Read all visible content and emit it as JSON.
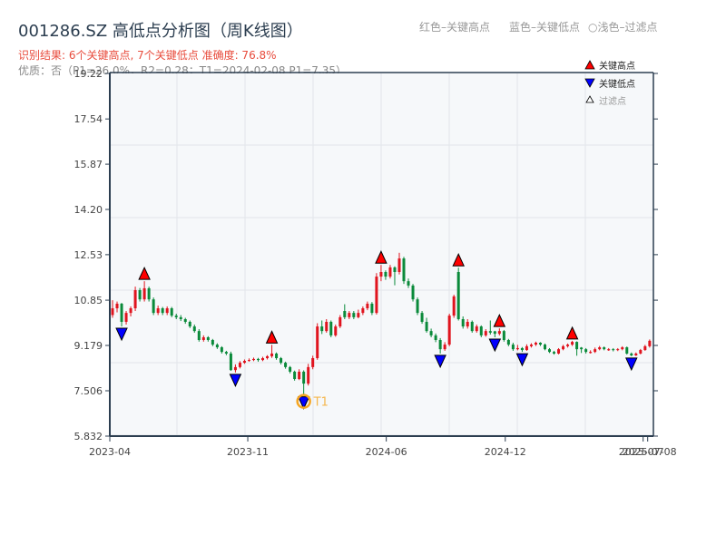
{
  "header": {
    "title": "001286.SZ 高低点分析图（周K线图）",
    "result": "识别结果: 6个关键高点, 7个关键低点  准确度: 76.8%",
    "quality": "优质：否（P1=26.0%，R2=0.28；T1=2024-02-08 P1=7.35）"
  },
  "top_legend": {
    "red": "红色–关键高点",
    "blue": "蓝色–关键低点",
    "light": "○浅色–过滤点"
  },
  "chart_data": {
    "type": "candlestick",
    "title": "001286.SZ 高低点分析图（周K线图）",
    "y_ticks": [
      "5.832",
      "7.506",
      "9.179",
      "10.85",
      "12.53",
      "14.20",
      "15.87",
      "17.54",
      "19.22"
    ],
    "ylim": [
      5.832,
      19.22
    ],
    "x_ticks": [
      {
        "label": "2023-04",
        "date": "2023-04-07"
      },
      {
        "label": "2023-11",
        "date": "2023-11-01"
      },
      {
        "label": "2024-06",
        "date": "2024-06-01"
      },
      {
        "label": "2024-12",
        "date": "2024-12-01"
      },
      {
        "label": "2025-07",
        "date": "2025-07-01"
      },
      {
        "label": "2025-07-08",
        "date": "2025-07-08"
      }
    ],
    "xlim": [
      "2023-04-07",
      "2025-07-14"
    ],
    "grid": true,
    "colors": {
      "up": "#e0141e",
      "down": "#0a8a3a",
      "high_marker": "#ff0000",
      "low_marker": "#0000ff",
      "t1": "#f5a623",
      "plot_bg": "#f6f8fa"
    },
    "dates": [
      "2023-04-07",
      "2023-04-14",
      "2023-04-21",
      "2023-04-28",
      "2023-05-05",
      "2023-05-12",
      "2023-05-19",
      "2023-05-26",
      "2023-06-02",
      "2023-06-09",
      "2023-06-16",
      "2023-06-23",
      "2023-06-30",
      "2023-07-07",
      "2023-07-14",
      "2023-07-21",
      "2023-07-28",
      "2023-08-04",
      "2023-08-11",
      "2023-08-18",
      "2023-08-25",
      "2023-09-01",
      "2023-09-08",
      "2023-09-15",
      "2023-09-22",
      "2023-09-29",
      "2023-10-06",
      "2023-10-13",
      "2023-10-20",
      "2023-10-27",
      "2023-11-03",
      "2023-11-10",
      "2023-11-17",
      "2023-11-24",
      "2023-12-01",
      "2023-12-08",
      "2023-12-15",
      "2023-12-22",
      "2023-12-29",
      "2024-01-05",
      "2024-01-12",
      "2024-01-19",
      "2024-01-26",
      "2024-02-02",
      "2024-02-09",
      "2024-02-16",
      "2024-02-23",
      "2024-03-01",
      "2024-03-08",
      "2024-03-15",
      "2024-03-22",
      "2024-03-29",
      "2024-04-05",
      "2024-04-12",
      "2024-04-19",
      "2024-04-26",
      "2024-05-03",
      "2024-05-10",
      "2024-05-17",
      "2024-05-24",
      "2024-05-31",
      "2024-06-07",
      "2024-06-14",
      "2024-06-21",
      "2024-06-28",
      "2024-07-05",
      "2024-07-12",
      "2024-07-19",
      "2024-07-26",
      "2024-08-02",
      "2024-08-09",
      "2024-08-16",
      "2024-08-23",
      "2024-08-30",
      "2024-09-06",
      "2024-09-13",
      "2024-09-20",
      "2024-09-27",
      "2024-10-04",
      "2024-10-11",
      "2024-10-18",
      "2024-10-25",
      "2024-11-01",
      "2024-11-08",
      "2024-11-15",
      "2024-11-22",
      "2024-11-29",
      "2024-12-06",
      "2024-12-13",
      "2024-12-20",
      "2024-12-27",
      "2025-01-03",
      "2025-01-10",
      "2025-01-17",
      "2025-01-24",
      "2025-01-31",
      "2025-02-07",
      "2025-02-14",
      "2025-02-21",
      "2025-02-28",
      "2025-03-07",
      "2025-03-14",
      "2025-03-21",
      "2025-03-28",
      "2025-04-04",
      "2025-04-11",
      "2025-04-18",
      "2025-04-25",
      "2025-05-02",
      "2025-05-09",
      "2025-05-16",
      "2025-05-23",
      "2025-05-30",
      "2025-06-06",
      "2025-06-13",
      "2025-06-20",
      "2025-06-27",
      "2025-07-04",
      "2025-07-11"
    ],
    "ohlc": [
      [
        10.3,
        10.85,
        10.2,
        10.55
      ],
      [
        10.55,
        10.8,
        10.4,
        10.72
      ],
      [
        10.72,
        10.75,
        9.88,
        10.05
      ],
      [
        10.05,
        10.45,
        9.95,
        10.38
      ],
      [
        10.38,
        10.62,
        10.25,
        10.55
      ],
      [
        10.55,
        11.35,
        10.45,
        11.22
      ],
      [
        11.22,
        11.3,
        10.8,
        10.88
      ],
      [
        10.88,
        11.55,
        10.8,
        11.29
      ],
      [
        11.29,
        11.35,
        10.8,
        10.88
      ],
      [
        10.88,
        10.95,
        10.3,
        10.38
      ],
      [
        10.38,
        10.65,
        10.3,
        10.55
      ],
      [
        10.55,
        10.6,
        10.3,
        10.38
      ],
      [
        10.38,
        10.62,
        10.3,
        10.55
      ],
      [
        10.55,
        10.6,
        10.22,
        10.28
      ],
      [
        10.28,
        10.35,
        10.15,
        10.22
      ],
      [
        10.22,
        10.3,
        10.08,
        10.15
      ],
      [
        10.15,
        10.2,
        9.98,
        10.05
      ],
      [
        10.05,
        10.1,
        9.82,
        9.88
      ],
      [
        9.88,
        9.95,
        9.65,
        9.71
      ],
      [
        9.71,
        9.78,
        9.32,
        9.38
      ],
      [
        9.38,
        9.55,
        9.32,
        9.48
      ],
      [
        9.48,
        9.52,
        9.32,
        9.38
      ],
      [
        9.38,
        9.42,
        9.15,
        9.21
      ],
      [
        9.21,
        9.26,
        9.05,
        9.11
      ],
      [
        9.11,
        9.15,
        8.88,
        8.94
      ],
      [
        8.94,
        8.98,
        8.82,
        8.88
      ],
      [
        8.88,
        8.95,
        8.24,
        8.27
      ],
      [
        8.27,
        8.48,
        8.18,
        8.38
      ],
      [
        8.38,
        8.6,
        8.33,
        8.54
      ],
      [
        8.54,
        8.66,
        8.5,
        8.61
      ],
      [
        8.61,
        8.7,
        8.58,
        8.64
      ],
      [
        8.64,
        8.73,
        8.6,
        8.68
      ],
      [
        8.68,
        8.72,
        8.58,
        8.64
      ],
      [
        8.64,
        8.76,
        8.6,
        8.71
      ],
      [
        8.71,
        8.82,
        8.66,
        8.78
      ],
      [
        8.78,
        9.2,
        8.72,
        8.88
      ],
      [
        8.88,
        8.92,
        8.65,
        8.71
      ],
      [
        8.71,
        8.75,
        8.48,
        8.54
      ],
      [
        8.54,
        8.58,
        8.32,
        8.38
      ],
      [
        8.38,
        8.42,
        8.15,
        8.21
      ],
      [
        8.21,
        8.25,
        7.88,
        7.94
      ],
      [
        7.94,
        8.3,
        7.9,
        8.21
      ],
      [
        8.21,
        8.26,
        7.35,
        7.77
      ],
      [
        7.77,
        8.5,
        7.7,
        8.38
      ],
      [
        8.38,
        8.8,
        8.3,
        8.71
      ],
      [
        8.71,
        10.0,
        8.65,
        9.88
      ],
      [
        9.88,
        10.1,
        9.6,
        9.71
      ],
      [
        9.71,
        10.15,
        9.65,
        10.05
      ],
      [
        10.05,
        10.1,
        9.48,
        9.55
      ],
      [
        9.55,
        9.95,
        9.5,
        9.88
      ],
      [
        9.88,
        10.3,
        9.82,
        10.22
      ],
      [
        10.45,
        10.7,
        10.15,
        10.22
      ],
      [
        10.22,
        10.45,
        10.15,
        10.38
      ],
      [
        10.38,
        10.45,
        10.15,
        10.22
      ],
      [
        10.22,
        10.5,
        10.18,
        10.38
      ],
      [
        10.38,
        10.62,
        10.3,
        10.55
      ],
      [
        10.55,
        10.8,
        10.48,
        10.72
      ],
      [
        10.72,
        10.78,
        10.3,
        10.38
      ],
      [
        10.38,
        11.85,
        10.32,
        11.72
      ],
      [
        11.72,
        12.15,
        11.55,
        11.89
      ],
      [
        11.89,
        11.95,
        11.6,
        11.72
      ],
      [
        11.72,
        12.15,
        11.65,
        12.06
      ],
      [
        12.06,
        12.1,
        11.4,
        11.89
      ],
      [
        11.89,
        12.6,
        11.8,
        12.39
      ],
      [
        12.39,
        12.45,
        11.45,
        11.55
      ],
      [
        11.55,
        11.65,
        11.3,
        11.39
      ],
      [
        11.39,
        11.45,
        10.8,
        10.88
      ],
      [
        10.88,
        10.95,
        10.3,
        10.38
      ],
      [
        10.38,
        10.45,
        9.98,
        10.05
      ],
      [
        10.05,
        10.2,
        9.65,
        9.71
      ],
      [
        9.71,
        9.8,
        9.48,
        9.55
      ],
      [
        9.55,
        9.62,
        9.3,
        9.38
      ],
      [
        9.38,
        9.45,
        8.88,
        9.04
      ],
      [
        9.04,
        9.3,
        8.98,
        9.21
      ],
      [
        9.21,
        10.35,
        9.15,
        10.28
      ],
      [
        10.28,
        11.05,
        10.2,
        10.99
      ],
      [
        11.89,
        12.05,
        10.1,
        10.15
      ],
      [
        10.15,
        10.25,
        9.8,
        9.88
      ],
      [
        9.88,
        10.15,
        9.8,
        10.05
      ],
      [
        10.05,
        10.1,
        9.65,
        9.71
      ],
      [
        9.71,
        9.95,
        9.65,
        9.88
      ],
      [
        9.88,
        9.92,
        9.48,
        9.55
      ],
      [
        9.55,
        9.78,
        9.5,
        9.71
      ],
      [
        9.71,
        10.1,
        9.58,
        9.65
      ],
      [
        9.7,
        9.72,
        9.48,
        9.61
      ],
      [
        9.61,
        9.81,
        9.55,
        9.71
      ],
      [
        9.71,
        9.75,
        9.32,
        9.38
      ],
      [
        9.38,
        9.42,
        9.15,
        9.21
      ],
      [
        9.21,
        9.28,
        8.98,
        9.04
      ],
      [
        9.04,
        9.2,
        9.0,
        9.08
      ],
      [
        9.08,
        9.12,
        8.94,
        9.01
      ],
      [
        9.01,
        9.22,
        8.98,
        9.15
      ],
      [
        9.15,
        9.26,
        9.1,
        9.21
      ],
      [
        9.21,
        9.32,
        9.16,
        9.28
      ],
      [
        9.28,
        9.3,
        9.16,
        9.21
      ],
      [
        9.21,
        9.25,
        9.0,
        9.04
      ],
      [
        9.04,
        9.08,
        8.9,
        8.94
      ],
      [
        8.94,
        8.98,
        8.84,
        8.88
      ],
      [
        8.88,
        9.08,
        8.85,
        9.04
      ],
      [
        9.04,
        9.2,
        9.0,
        9.15
      ],
      [
        9.15,
        9.25,
        9.1,
        9.21
      ],
      [
        9.21,
        9.35,
        9.16,
        9.31
      ],
      [
        9.31,
        9.33,
        8.8,
        9.04
      ],
      [
        9.1,
        9.12,
        8.9,
        9.04
      ],
      [
        9.04,
        9.08,
        8.88,
        8.94
      ],
      [
        8.9,
        9.0,
        8.88,
        8.94
      ],
      [
        8.94,
        9.1,
        8.9,
        9.04
      ],
      [
        9.04,
        9.16,
        9.0,
        9.11
      ],
      [
        9.11,
        9.14,
        9.0,
        9.04
      ],
      [
        9.0,
        9.08,
        8.98,
        9.04
      ],
      [
        9.04,
        9.08,
        8.96,
        9.01
      ],
      [
        9.01,
        9.08,
        8.97,
        9.04
      ],
      [
        9.04,
        9.15,
        9.0,
        9.11
      ],
      [
        9.11,
        9.14,
        8.84,
        8.88
      ],
      [
        8.88,
        8.92,
        8.78,
        8.81
      ],
      [
        8.81,
        8.92,
        8.79,
        8.88
      ],
      [
        8.88,
        9.05,
        8.85,
        9.01
      ],
      [
        9.01,
        9.2,
        8.98,
        9.15
      ],
      [
        9.15,
        9.4,
        9.1,
        9.35
      ]
    ],
    "key_highs": [
      "2023-05-26",
      "2023-12-08",
      "2024-05-24",
      "2024-09-20",
      "2024-11-22",
      "2025-03-14"
    ],
    "key_lows": [
      "2023-04-21",
      "2023-10-13",
      "2024-01-26",
      "2024-08-23",
      "2024-11-15",
      "2024-12-27",
      "2025-06-13"
    ],
    "t1": {
      "label": "T1",
      "date": "2024-01-26"
    },
    "legend": {
      "position": "top-right",
      "items": [
        {
          "label": "关键高点",
          "marker": "triangle-up",
          "color": "#ff0000"
        },
        {
          "label": "关键低点",
          "marker": "triangle-down",
          "color": "#0000ff"
        },
        {
          "label": "过滤点",
          "marker": "triangle-up-outline",
          "color": "#ffffff"
        }
      ]
    }
  }
}
